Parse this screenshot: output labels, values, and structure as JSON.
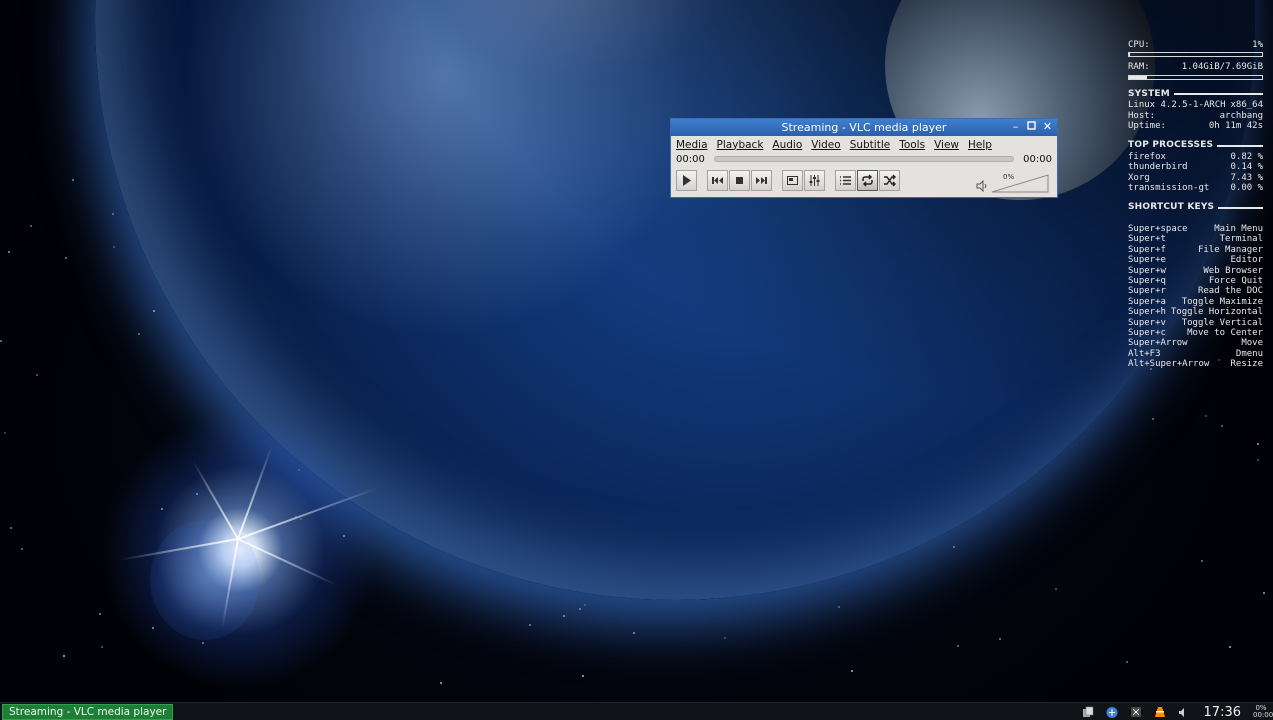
{
  "conky": {
    "cpu_label": "CPU:",
    "cpu_value": "1%",
    "cpu_fraction": 0.01,
    "ram_label": "RAM:",
    "ram_value": "1.04GiB/7.69GiB",
    "ram_fraction": 0.135,
    "system_header": "SYSTEM",
    "system": [
      {
        "label": "Linux 4.2.5-1-ARCH",
        "value": "x86_64"
      },
      {
        "label": "Host:",
        "value": "archbang"
      },
      {
        "label": "Uptime:",
        "value": "0h 11m 42s"
      }
    ],
    "processes_header": "TOP PROCESSES",
    "processes": [
      {
        "name": "firefox",
        "value": "0.82 %"
      },
      {
        "name": "thunderbird",
        "value": "0.14 %"
      },
      {
        "name": "Xorg",
        "value": "7.43 %"
      },
      {
        "name": "transmission-gt",
        "value": "0.00 %"
      }
    ],
    "shortcuts_header": "SHORTCUT KEYS",
    "shortcuts": [
      {
        "key": "Super+space",
        "action": "Main Menu"
      },
      {
        "key": "Super+t",
        "action": "Terminal"
      },
      {
        "key": "Super+f",
        "action": "File Manager"
      },
      {
        "key": "Super+e",
        "action": "Editor"
      },
      {
        "key": "Super+w",
        "action": "Web Browser"
      },
      {
        "key": "Super+q",
        "action": "Force Quit"
      },
      {
        "key": "Super+r",
        "action": "Read the DOC"
      },
      {
        "key": "Super+a",
        "action": "Toggle Maximize"
      },
      {
        "key": "Super+h",
        "action": "Toggle Horizontal"
      },
      {
        "key": "Super+v",
        "action": "Toggle Vertical"
      },
      {
        "key": "Super+c",
        "action": "Move to Center"
      },
      {
        "key": "Super+Arrow",
        "action": "Move"
      },
      {
        "key": "Alt+F3",
        "action": "Dmenu"
      },
      {
        "key": "Alt+Super+Arrow",
        "action": "Resize"
      }
    ]
  },
  "vlc": {
    "title": "Streaming - VLC media player",
    "menu": [
      "Media",
      "Playback",
      "Audio",
      "Video",
      "Subtitle",
      "Tools",
      "View",
      "Help"
    ],
    "time_elapsed": "00:00",
    "time_total": "00:00",
    "volume_label": "0%",
    "controls": [
      "play-icon",
      "previous-icon",
      "stop-icon",
      "next-icon",
      "fullscreen-icon",
      "extended-settings-icon",
      "playlist-icon",
      "loop-icon",
      "shuffle-icon"
    ],
    "volume_icon": "speaker-icon"
  },
  "taskbar": {
    "task_label": "Streaming - VLC media player",
    "clock": "17:36",
    "tray_pct_top": "0%",
    "tray_pct_bottom": "00:00",
    "tray_icons": [
      "files-icon",
      "network-icon",
      "vlc-tray-icon",
      "volume-icon"
    ]
  },
  "colors": {
    "vlc_titlebar": "#2f6bbd",
    "task_button": "#1f7d38",
    "taskbar_bg": "#101418"
  }
}
